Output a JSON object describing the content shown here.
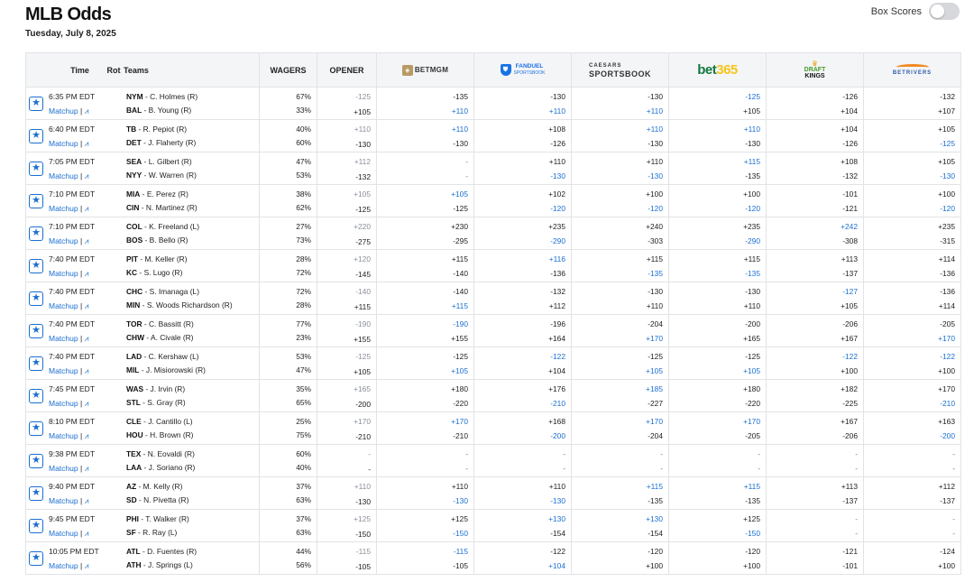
{
  "header": {
    "title": "MLB Odds",
    "date": "Tuesday, July 8, 2025",
    "box_scores_label": "Box Scores"
  },
  "table": {
    "col_time": "Time",
    "col_rot": "Rot",
    "col_teams": "Teams",
    "col_wagers": "WAGERS",
    "col_opener": "OPENER",
    "books": {
      "betmgm": "BETMGM",
      "fanduel": "FANDUEL",
      "fanduel_sub": "SPORTSBOOK",
      "caesars_top": "CAESARS",
      "caesars_bottom": "SPORTSBOOK",
      "bet365_a": "bet",
      "bet365_b": "365",
      "dk_a": "DRAFT",
      "dk_b": "KINGS",
      "betrivers": "BETRIVERS"
    },
    "matchup_label": "Matchup",
    "games": [
      {
        "time": "6:35 PM EDT",
        "away": {
          "abbr": "NYM",
          "pitcher": "C. Holmes (R)"
        },
        "home": {
          "abbr": "BAL",
          "pitcher": "B. Young (R)"
        },
        "wagers": [
          "67%",
          "33%"
        ],
        "opener": [
          "-125",
          "+105"
        ],
        "books": [
          [
            "-135",
            "+110"
          ],
          [
            "-130",
            "+110"
          ],
          [
            "-130",
            "+110"
          ],
          [
            "-125",
            "+105"
          ],
          [
            "-126",
            "+104"
          ],
          [
            "-132",
            "+107"
          ]
        ],
        "blue": [
          [
            0,
            1
          ],
          [
            1,
            1
          ],
          [
            2,
            1
          ],
          [
            3,
            0
          ]
        ]
      },
      {
        "time": "6:40 PM EDT",
        "away": {
          "abbr": "TB",
          "pitcher": "R. Pepiot (R)"
        },
        "home": {
          "abbr": "DET",
          "pitcher": "J. Flaherty (R)"
        },
        "wagers": [
          "40%",
          "60%"
        ],
        "opener": [
          "+110",
          "-130"
        ],
        "books": [
          [
            "+110",
            "-130"
          ],
          [
            "+108",
            "-126"
          ],
          [
            "+110",
            "-130"
          ],
          [
            "+110",
            "-130"
          ],
          [
            "+104",
            "-126"
          ],
          [
            "+105",
            "-125"
          ]
        ],
        "blue": [
          [
            0,
            0
          ],
          [
            2,
            0
          ],
          [
            3,
            0
          ],
          [
            5,
            1
          ]
        ]
      },
      {
        "time": "7:05 PM EDT",
        "away": {
          "abbr": "SEA",
          "pitcher": "L. Gilbert (R)"
        },
        "home": {
          "abbr": "NYY",
          "pitcher": "W. Warren (R)"
        },
        "wagers": [
          "47%",
          "53%"
        ],
        "opener": [
          "+112",
          "-132"
        ],
        "books": [
          [
            "-",
            "-"
          ],
          [
            "+110",
            "-130"
          ],
          [
            "+110",
            "-130"
          ],
          [
            "+115",
            "-135"
          ],
          [
            "+108",
            "-132"
          ],
          [
            "+105",
            "-130"
          ]
        ],
        "blue": [
          [
            1,
            1
          ],
          [
            2,
            1
          ],
          [
            3,
            0
          ],
          [
            5,
            1
          ]
        ]
      },
      {
        "time": "7:10 PM EDT",
        "away": {
          "abbr": "MIA",
          "pitcher": "E. Perez (R)"
        },
        "home": {
          "abbr": "CIN",
          "pitcher": "N. Martinez (R)"
        },
        "wagers": [
          "38%",
          "62%"
        ],
        "opener": [
          "+105",
          "-125"
        ],
        "books": [
          [
            "+105",
            "-125"
          ],
          [
            "+102",
            "-120"
          ],
          [
            "+100",
            "-120"
          ],
          [
            "+100",
            "-120"
          ],
          [
            "-101",
            "-121"
          ],
          [
            "+100",
            "-120"
          ]
        ],
        "blue": [
          [
            0,
            0
          ],
          [
            1,
            1
          ],
          [
            2,
            1
          ],
          [
            3,
            1
          ],
          [
            5,
            1
          ]
        ]
      },
      {
        "time": "7:10 PM EDT",
        "away": {
          "abbr": "COL",
          "pitcher": "K. Freeland (L)"
        },
        "home": {
          "abbr": "BOS",
          "pitcher": "B. Bello (R)"
        },
        "wagers": [
          "27%",
          "73%"
        ],
        "opener": [
          "+220",
          "-275"
        ],
        "books": [
          [
            "+230",
            "-295"
          ],
          [
            "+235",
            "-290"
          ],
          [
            "+240",
            "-303"
          ],
          [
            "+235",
            "-290"
          ],
          [
            "+242",
            "-308"
          ],
          [
            "+235",
            "-315"
          ]
        ],
        "blue": [
          [
            1,
            1
          ],
          [
            3,
            1
          ],
          [
            4,
            0
          ]
        ]
      },
      {
        "time": "7:40 PM EDT",
        "away": {
          "abbr": "PIT",
          "pitcher": "M. Keller (R)"
        },
        "home": {
          "abbr": "KC",
          "pitcher": "S. Lugo (R)"
        },
        "wagers": [
          "28%",
          "72%"
        ],
        "opener": [
          "+120",
          "-145"
        ],
        "books": [
          [
            "+115",
            "-140"
          ],
          [
            "+116",
            "-136"
          ],
          [
            "+115",
            "-135"
          ],
          [
            "+115",
            "-135"
          ],
          [
            "+113",
            "-137"
          ],
          [
            "+114",
            "-136"
          ]
        ],
        "blue": [
          [
            1,
            0
          ],
          [
            2,
            1
          ],
          [
            3,
            1
          ]
        ]
      },
      {
        "time": "7:40 PM EDT",
        "away": {
          "abbr": "CHC",
          "pitcher": "S. Imanaga (L)"
        },
        "home": {
          "abbr": "MIN",
          "pitcher": "S. Woods Richardson (R)"
        },
        "wagers": [
          "72%",
          "28%"
        ],
        "opener": [
          "-140",
          "+115"
        ],
        "books": [
          [
            "-140",
            "+115"
          ],
          [
            "-132",
            "+112"
          ],
          [
            "-130",
            "+110"
          ],
          [
            "-130",
            "+110"
          ],
          [
            "-127",
            "+105"
          ],
          [
            "-136",
            "+114"
          ]
        ],
        "blue": [
          [
            0,
            1
          ],
          [
            4,
            0
          ]
        ]
      },
      {
        "time": "7:40 PM EDT",
        "away": {
          "abbr": "TOR",
          "pitcher": "C. Bassitt (R)"
        },
        "home": {
          "abbr": "CHW",
          "pitcher": "A. Civale (R)"
        },
        "wagers": [
          "77%",
          "23%"
        ],
        "opener": [
          "-190",
          "+155"
        ],
        "books": [
          [
            "-190",
            "+155"
          ],
          [
            "-196",
            "+164"
          ],
          [
            "-204",
            "+170"
          ],
          [
            "-200",
            "+165"
          ],
          [
            "-206",
            "+167"
          ],
          [
            "-205",
            "+170"
          ]
        ],
        "blue": [
          [
            0,
            0
          ],
          [
            2,
            1
          ],
          [
            5,
            1
          ]
        ]
      },
      {
        "time": "7:40 PM EDT",
        "away": {
          "abbr": "LAD",
          "pitcher": "C. Kershaw (L)"
        },
        "home": {
          "abbr": "MIL",
          "pitcher": "J. Misiorowski (R)"
        },
        "wagers": [
          "53%",
          "47%"
        ],
        "opener": [
          "-125",
          "+105"
        ],
        "books": [
          [
            "-125",
            "+105"
          ],
          [
            "-122",
            "+104"
          ],
          [
            "-125",
            "+105"
          ],
          [
            "-125",
            "+105"
          ],
          [
            "-122",
            "+100"
          ],
          [
            "-122",
            "+100"
          ]
        ],
        "blue": [
          [
            0,
            1
          ],
          [
            1,
            0
          ],
          [
            2,
            1
          ],
          [
            3,
            1
          ],
          [
            4,
            0
          ],
          [
            5,
            0
          ]
        ]
      },
      {
        "time": "7:45 PM EDT",
        "away": {
          "abbr": "WAS",
          "pitcher": "J. Irvin (R)"
        },
        "home": {
          "abbr": "STL",
          "pitcher": "S. Gray (R)"
        },
        "wagers": [
          "35%",
          "65%"
        ],
        "opener": [
          "+165",
          "-200"
        ],
        "books": [
          [
            "+180",
            "-220"
          ],
          [
            "+176",
            "-210"
          ],
          [
            "+185",
            "-227"
          ],
          [
            "+180",
            "-220"
          ],
          [
            "+182",
            "-225"
          ],
          [
            "+170",
            "-210"
          ]
        ],
        "blue": [
          [
            1,
            1
          ],
          [
            2,
            0
          ],
          [
            5,
            1
          ]
        ]
      },
      {
        "time": "8:10 PM EDT",
        "away": {
          "abbr": "CLE",
          "pitcher": "J. Cantillo (L)"
        },
        "home": {
          "abbr": "HOU",
          "pitcher": "H. Brown (R)"
        },
        "wagers": [
          "25%",
          "75%"
        ],
        "opener": [
          "+170",
          "-210"
        ],
        "books": [
          [
            "+170",
            "-210"
          ],
          [
            "+168",
            "-200"
          ],
          [
            "+170",
            "-204"
          ],
          [
            "+170",
            "-205"
          ],
          [
            "+167",
            "-206"
          ],
          [
            "+163",
            "-200"
          ]
        ],
        "blue": [
          [
            0,
            0
          ],
          [
            1,
            1
          ],
          [
            2,
            0
          ],
          [
            3,
            0
          ],
          [
            5,
            1
          ]
        ]
      },
      {
        "time": "9:38 PM EDT",
        "away": {
          "abbr": "TEX",
          "pitcher": "N. Eovaldi (R)"
        },
        "home": {
          "abbr": "LAA",
          "pitcher": "J. Soriano (R)"
        },
        "wagers": [
          "60%",
          "40%"
        ],
        "opener": [
          "-",
          "-"
        ],
        "books": [
          [
            "-",
            "-"
          ],
          [
            "-",
            "-"
          ],
          [
            "-",
            "-"
          ],
          [
            "-",
            "-"
          ],
          [
            "-",
            "-"
          ],
          [
            "-",
            "-"
          ]
        ],
        "blue": []
      },
      {
        "time": "9:40 PM EDT",
        "away": {
          "abbr": "AZ",
          "pitcher": "M. Kelly (R)"
        },
        "home": {
          "abbr": "SD",
          "pitcher": "N. Pivetta (R)"
        },
        "wagers": [
          "37%",
          "63%"
        ],
        "opener": [
          "+110",
          "-130"
        ],
        "books": [
          [
            "+110",
            "-130"
          ],
          [
            "+110",
            "-130"
          ],
          [
            "+115",
            "-135"
          ],
          [
            "+115",
            "-135"
          ],
          [
            "+113",
            "-137"
          ],
          [
            "+112",
            "-137"
          ]
        ],
        "blue": [
          [
            0,
            1
          ],
          [
            1,
            1
          ],
          [
            2,
            0
          ],
          [
            3,
            0
          ]
        ]
      },
      {
        "time": "9:45 PM EDT",
        "away": {
          "abbr": "PHI",
          "pitcher": "T. Walker (R)"
        },
        "home": {
          "abbr": "SF",
          "pitcher": "R. Ray (L)"
        },
        "wagers": [
          "37%",
          "63%"
        ],
        "opener": [
          "+125",
          "-150"
        ],
        "books": [
          [
            "+125",
            "-150"
          ],
          [
            "+130",
            "-154"
          ],
          [
            "+130",
            "-154"
          ],
          [
            "+125",
            "-150"
          ],
          [
            "-",
            "-"
          ],
          [
            "-",
            "-"
          ]
        ],
        "blue": [
          [
            0,
            1
          ],
          [
            1,
            0
          ],
          [
            2,
            0
          ],
          [
            3,
            1
          ]
        ]
      },
      {
        "time": "10:05 PM EDT",
        "away": {
          "abbr": "ATL",
          "pitcher": "D. Fuentes (R)"
        },
        "home": {
          "abbr": "ATH",
          "pitcher": "J. Springs (L)"
        },
        "wagers": [
          "44%",
          "56%"
        ],
        "opener": [
          "-115",
          "-105"
        ],
        "books": [
          [
            "-115",
            "-105"
          ],
          [
            "-122",
            "+104"
          ],
          [
            "-120",
            "+100"
          ],
          [
            "-120",
            "+100"
          ],
          [
            "-121",
            "-101"
          ],
          [
            "-124",
            "+100"
          ]
        ],
        "blue": [
          [
            0,
            0
          ],
          [
            1,
            1
          ]
        ]
      }
    ]
  },
  "colors": {
    "accent": "#1a6fd0",
    "header_bg": "#f4f5f7",
    "border": "#e1e3e6",
    "muted": "#8a8f99"
  },
  "icons": {
    "favorite": "star-icon",
    "trend": "trend-chart-icon"
  }
}
